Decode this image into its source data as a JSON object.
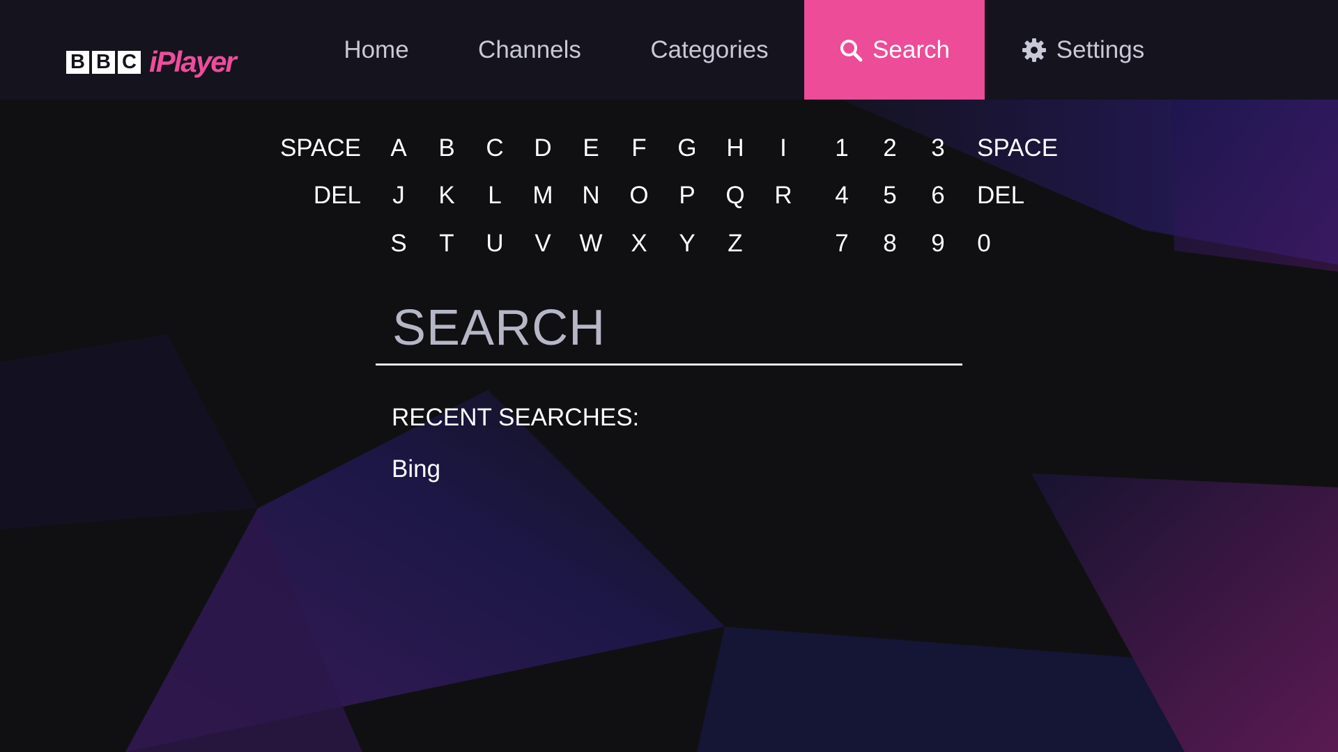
{
  "header": {
    "logo": {
      "bbc_letters": [
        "B",
        "B",
        "C"
      ],
      "product": "iPlayer"
    },
    "nav": [
      {
        "id": "home",
        "label": "Home",
        "active": false
      },
      {
        "id": "channels",
        "label": "Channels",
        "active": false
      },
      {
        "id": "categories",
        "label": "Categories",
        "active": false
      },
      {
        "id": "search",
        "label": "Search",
        "active": true,
        "icon": "search-icon"
      },
      {
        "id": "settings",
        "label": "Settings",
        "active": false,
        "icon": "gear-icon"
      }
    ]
  },
  "keyboard": {
    "rows": [
      {
        "left": "SPACE",
        "letters": [
          "A",
          "B",
          "C",
          "D",
          "E",
          "F",
          "G",
          "H",
          "I"
        ],
        "digits": [
          "1",
          "2",
          "3"
        ],
        "right": "SPACE"
      },
      {
        "left": "DEL",
        "letters": [
          "J",
          "K",
          "L",
          "M",
          "N",
          "O",
          "P",
          "Q",
          "R"
        ],
        "digits": [
          "4",
          "5",
          "6"
        ],
        "right": "DEL"
      },
      {
        "left": "",
        "letters": [
          "S",
          "T",
          "U",
          "V",
          "W",
          "X",
          "Y",
          "Z"
        ],
        "digits": [
          "7",
          "8",
          "9"
        ],
        "right": "0"
      }
    ]
  },
  "search": {
    "placeholder": "SEARCH",
    "value": ""
  },
  "recent": {
    "title": "RECENT SEARCHES:",
    "items": [
      "Bing"
    ]
  },
  "colors": {
    "accent": "#ec4c98",
    "topbar": "#14131e",
    "background": "#0e0d10"
  }
}
